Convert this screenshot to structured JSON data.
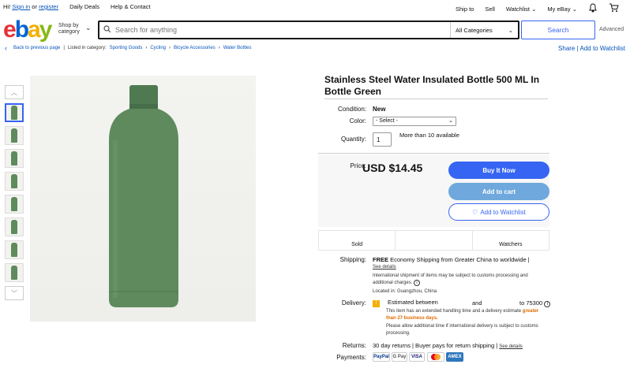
{
  "topbar": {
    "greeting": "Hi!",
    "sign_in": "Sign in",
    "or": "or",
    "register": "register",
    "daily_deals": "Daily Deals",
    "help": "Help & Contact",
    "ship_to": "Ship to",
    "sell": "Sell",
    "watchlist": "Watchlist",
    "my_ebay": "My eBay"
  },
  "logo": {
    "e": "e",
    "b": "b",
    "a": "a",
    "y": "y"
  },
  "header": {
    "shop_by_1": "Shop by",
    "shop_by_2": "category",
    "search_placeholder": "Search for anything",
    "category": "All Categories",
    "search_button": "Search",
    "advanced": "Advanced"
  },
  "breadcrumb": {
    "back": "Back to previous page",
    "listed_in": "Listed in category:",
    "items": [
      "Sporting Goods",
      "Cycling",
      "Bicycle Accessories",
      "Water Bottles"
    ],
    "share": "Share",
    "add_watchlist": "Add to Watchlist"
  },
  "product": {
    "title": "Stainless Steel Water Insulated Bottle 500 ML In Bottle Green",
    "condition_label": "Condition:",
    "condition": "New",
    "color_label": "Color:",
    "color_select": "- Select -",
    "quantity_label": "Quantity:",
    "quantity": "1",
    "available": "More than 10 available",
    "price_label": "Price:",
    "price": "USD $14.45",
    "buy_now": "Buy It Now",
    "add_to_cart": "Add to cart",
    "add_to_watchlist": "Add to Watchlist",
    "sold": "Sold",
    "watchers": "Watchers"
  },
  "shipping": {
    "label": "Shipping:",
    "free": "FREE",
    "text": "Economy Shipping from Greater China to worldwide |",
    "see_details": "See details",
    "note": "International shipment of items may be subject to customs processing and additional charges.",
    "location": "Located in: Guangzhou, China"
  },
  "delivery": {
    "label": "Delivery:",
    "estimated": "Estimated between",
    "and": "and",
    "to": "to 75300",
    "note_1": "This item has an extended handling time and a delivery estimate",
    "note_highlight": "greater than 27 business days.",
    "note_2": "Please allow additional time if international delivery is subject to customs processing."
  },
  "returns": {
    "label": "Returns:",
    "text": "30 day returns | Buyer pays for return shipping |",
    "see_details": "See details"
  },
  "payments": {
    "label": "Payments:",
    "methods": [
      "PayPal",
      "G Pay",
      "VISA",
      "MC",
      "AMEX"
    ]
  },
  "colors": {
    "brand_blue": "#3665f3",
    "link": "#0654ba",
    "bottle": "#5e8a5e",
    "highlight": "#dd6b00"
  }
}
